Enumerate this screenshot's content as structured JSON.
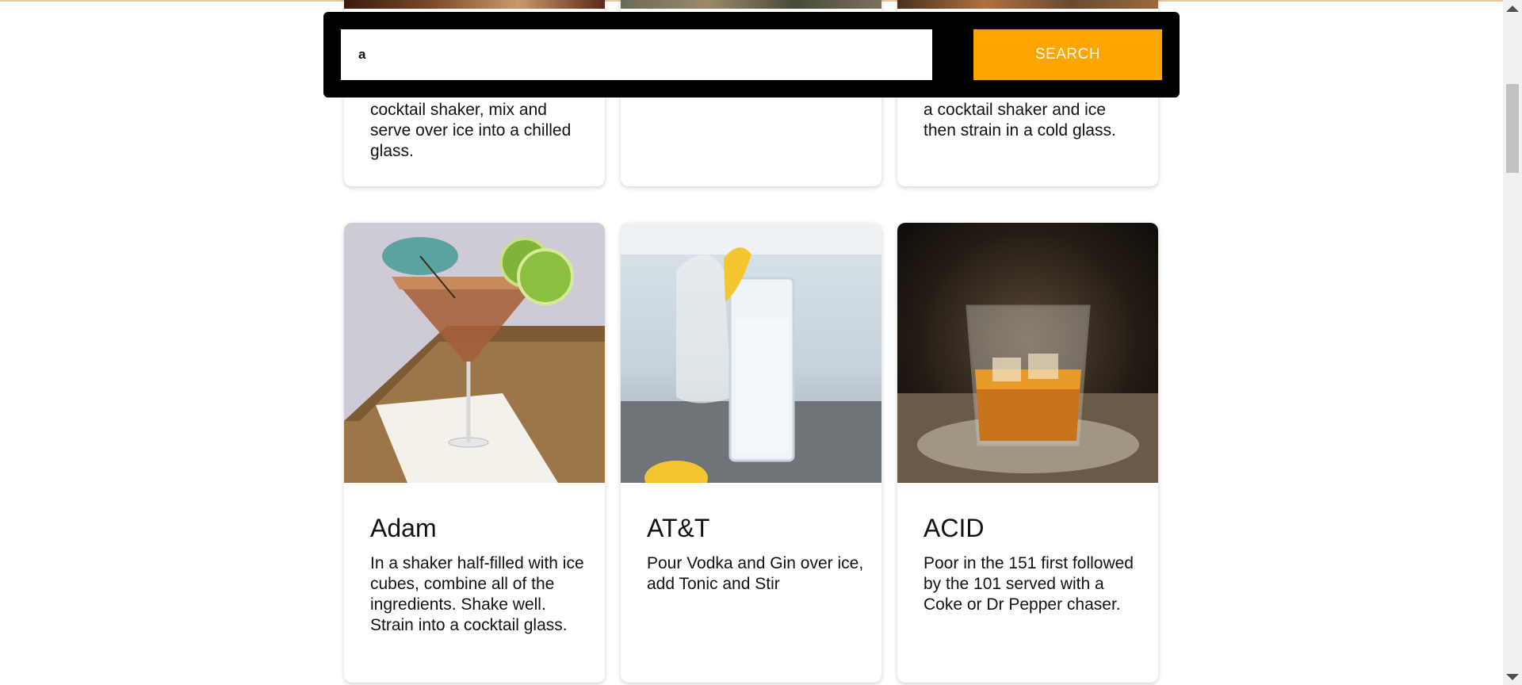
{
  "search": {
    "value": "a",
    "placeholder": "",
    "button_label": "SEARCH"
  },
  "cards": [
    {
      "name": "",
      "desc": "cocktail shaker, mix and serve over ice into a chilled glass."
    },
    {
      "name": "",
      "desc": ""
    },
    {
      "name": "",
      "desc": "a cocktail shaker and ice then strain in a cold glass."
    },
    {
      "name": "Adam",
      "desc": "In a shaker half-filled with ice cubes, combine all of the ingredients. Shake well. Strain into a cocktail glass."
    },
    {
      "name": "AT&T",
      "desc": "Pour Vodka and Gin over ice, add Tonic and Stir"
    },
    {
      "name": "ACID",
      "desc": "Poor in the 151 first followed by the 101 served with a Coke or Dr Pepper chaser."
    }
  ],
  "colors": {
    "accent": "#ffa500",
    "search_bar_bg": "#000000",
    "page_bg": "#ffffff"
  },
  "icons": {
    "scroll_up": "triangle-up-icon",
    "scroll_down": "triangle-down-icon"
  }
}
